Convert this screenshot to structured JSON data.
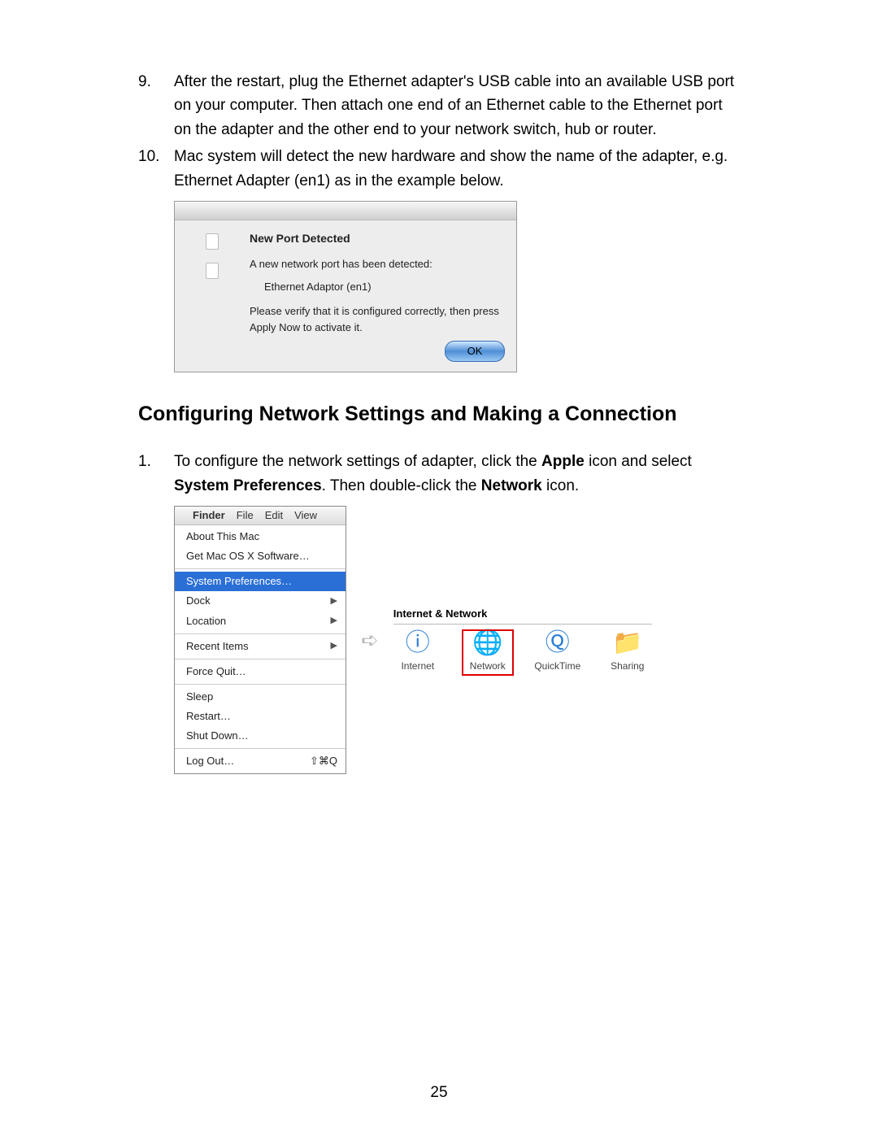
{
  "steps": [
    {
      "num": "9.",
      "text": "After the restart, plug the Ethernet adapter's USB cable into an available USB port on your computer. Then attach one end of an Ethernet cable to the Ethernet port on the adapter and the other end to your network switch, hub or router."
    },
    {
      "num": "10.",
      "text": "Mac system will detect the new hardware and show the name of the adapter, e.g. Ethernet Adapter (en1) as in the example below."
    }
  ],
  "dialog": {
    "title": "New Port Detected",
    "line1": "A new network port has been detected:",
    "portname": "Ethernet Adaptor (en1)",
    "line2": "Please verify that it is configured correctly, then press Apply Now to activate it.",
    "ok": "OK"
  },
  "heading": "Configuring Network Settings and Making a Connection",
  "substep": {
    "num": "1.",
    "pre": "To configure the network settings of adapter, click the ",
    "b1": "Apple",
    "mid": " icon and select ",
    "b2": "System Preferences",
    "mid2": ". Then double-click the ",
    "b3": "Network",
    "post": " icon."
  },
  "menubar": {
    "finder": "Finder",
    "file": "File",
    "edit": "Edit",
    "view": "View"
  },
  "menuitems": {
    "about": "About This Mac",
    "getsw": "Get Mac OS X Software…",
    "sysprefs": "System Preferences…",
    "dock": "Dock",
    "location": "Location",
    "recent": "Recent Items",
    "forcequit": "Force Quit…",
    "sleep": "Sleep",
    "restart": "Restart…",
    "shutdown": "Shut Down…",
    "logout": "Log Out…",
    "logout_sc": "⇧⌘Q"
  },
  "prefs": {
    "title": "Internet & Network",
    "internet": "Internet",
    "network": "Network",
    "quicktime": "QuickTime",
    "sharing": "Sharing"
  },
  "pagenum": "25"
}
